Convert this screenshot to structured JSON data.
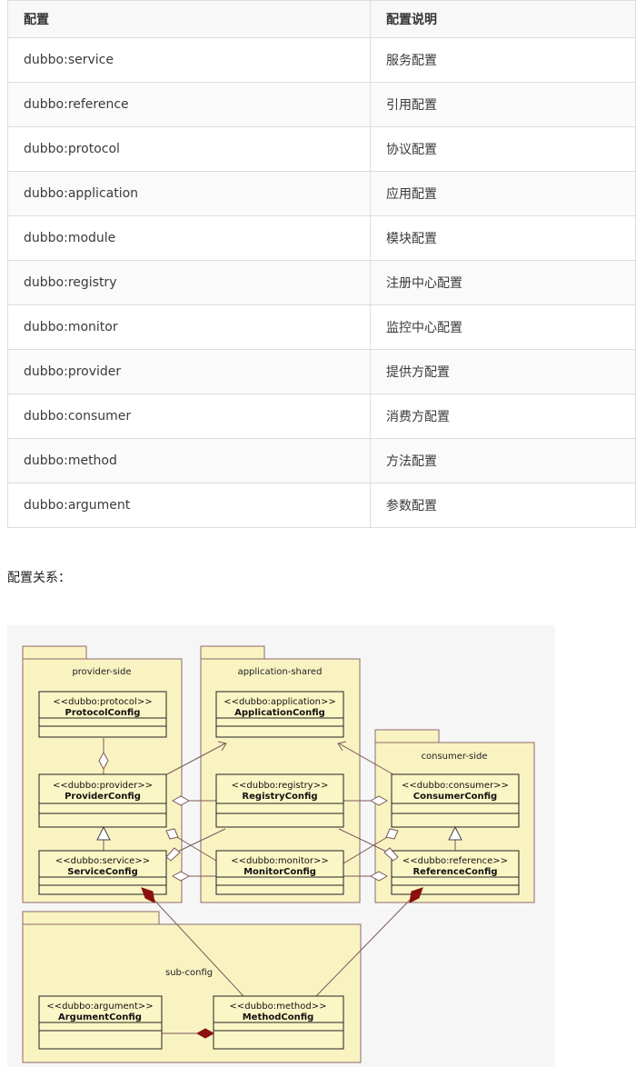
{
  "table": {
    "headers": [
      "配置",
      "配置说明"
    ],
    "rows": [
      [
        "dubbo:service",
        "服务配置"
      ],
      [
        "dubbo:reference",
        "引用配置"
      ],
      [
        "dubbo:protocol",
        "协议配置"
      ],
      [
        "dubbo:application",
        "应用配置"
      ],
      [
        "dubbo:module",
        "模块配置"
      ],
      [
        "dubbo:registry",
        "注册中心配置"
      ],
      [
        "dubbo:monitor",
        "监控中心配置"
      ],
      [
        "dubbo:provider",
        "提供方配置"
      ],
      [
        "dubbo:consumer",
        "消费方配置"
      ],
      [
        "dubbo:method",
        "方法配置"
      ],
      [
        "dubbo:argument",
        "参数配置"
      ]
    ]
  },
  "relation_heading": "配置关系：",
  "diagram": {
    "packages": {
      "provider": "provider-side",
      "application": "application-shared",
      "consumer": "consumer-side",
      "sub": "sub-config"
    },
    "classes": {
      "protocol": {
        "stereo": "<<dubbo:protocol>>",
        "name": "ProtocolConfig"
      },
      "application": {
        "stereo": "<<dubbo:application>>",
        "name": "ApplicationConfig"
      },
      "provider": {
        "stereo": "<<dubbo:provider>>",
        "name": "ProviderConfig"
      },
      "registry": {
        "stereo": "<<dubbo:registry>>",
        "name": "RegistryConfig"
      },
      "consumer": {
        "stereo": "<<dubbo:consumer>>",
        "name": "ConsumerConfig"
      },
      "service": {
        "stereo": "<<dubbo:service>>",
        "name": "ServiceConfig"
      },
      "monitor": {
        "stereo": "<<dubbo:monitor>>",
        "name": "MonitorConfig"
      },
      "reference": {
        "stereo": "<<dubbo:reference>>",
        "name": "ReferenceConfig"
      },
      "argument": {
        "stereo": "<<dubbo:argument>>",
        "name": "ArgumentConfig"
      },
      "method": {
        "stereo": "<<dubbo:method>>",
        "name": "MethodConfig"
      }
    }
  }
}
